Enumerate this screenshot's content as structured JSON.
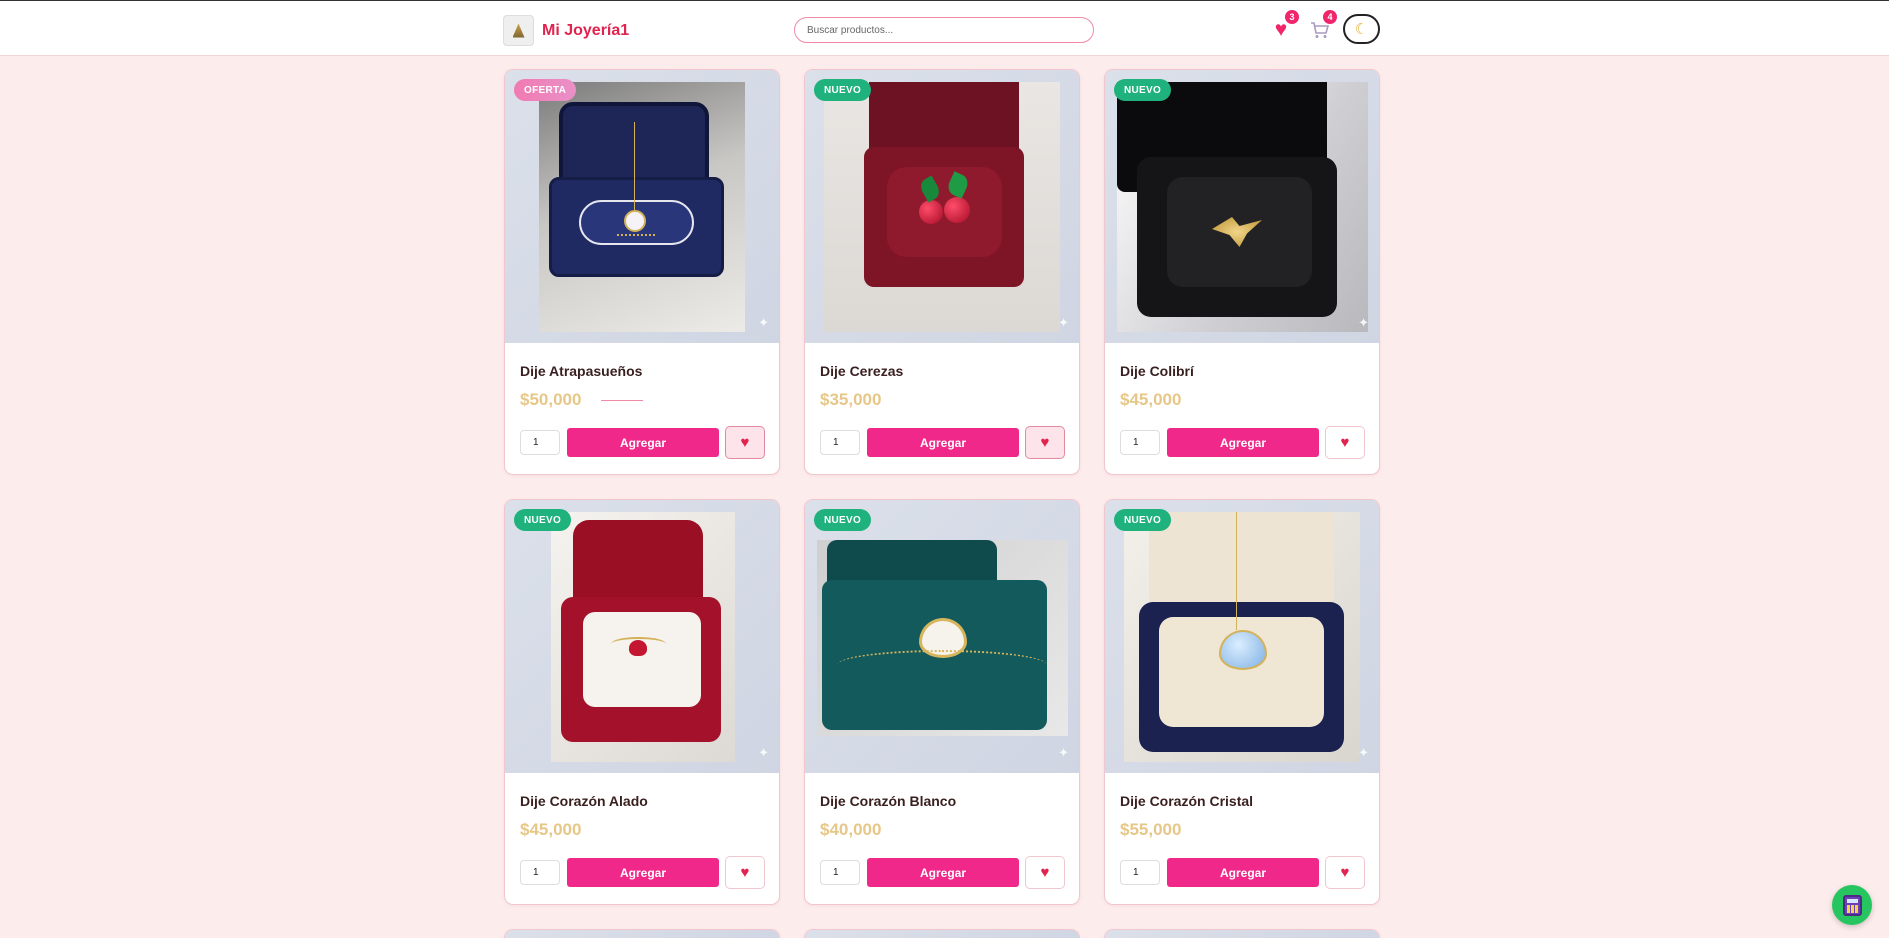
{
  "header": {
    "brand_name": "Mi Joyería1",
    "search_placeholder": "Buscar productos...",
    "favorites_count": "3",
    "cart_count": "4",
    "favorites_icon": "heart-icon",
    "cart_icon": "cart-icon",
    "theme_icon": "moon-icon"
  },
  "products": [
    {
      "name": "Dije Atrapasueños",
      "price": "$50,000",
      "badge": "OFERTA",
      "quantity": "1",
      "add_label": "Agregar",
      "favorited": true,
      "image": "dreamcatcher pendant in navy velvet box"
    },
    {
      "name": "Dije Cerezas",
      "price": "$35,000",
      "badge": "NUEVO",
      "quantity": "1",
      "add_label": "Agregar",
      "favorited": true,
      "image": "cherry pendant in burgundy box"
    },
    {
      "name": "Dije Colibrí",
      "price": "$45,000",
      "badge": "NUEVO",
      "quantity": "1",
      "add_label": "Agregar",
      "favorited": false,
      "image": "hummingbird pendant in black box"
    },
    {
      "name": "Dije Corazón Alado",
      "price": "$45,000",
      "badge": "NUEVO",
      "quantity": "1",
      "add_label": "Agregar",
      "favorited": false,
      "image": "winged heart pendant in red box"
    },
    {
      "name": "Dije Corazón Blanco",
      "price": "$40,000",
      "badge": "NUEVO",
      "quantity": "1",
      "add_label": "Agregar",
      "favorited": false,
      "image": "white heart bracelet in teal box"
    },
    {
      "name": "Dije Corazón Cristal",
      "price": "$55,000",
      "badge": "NUEVO",
      "quantity": "1",
      "add_label": "Agregar",
      "favorited": false,
      "image": "crystal heart pendant in navy box"
    }
  ],
  "colors": {
    "accent": "#f0288a",
    "brand": "#e1234f",
    "price": "#e7c788",
    "badge_new": "#1fb27c",
    "background": "#fdecec"
  },
  "floating": {
    "icon": "calculator-icon"
  }
}
